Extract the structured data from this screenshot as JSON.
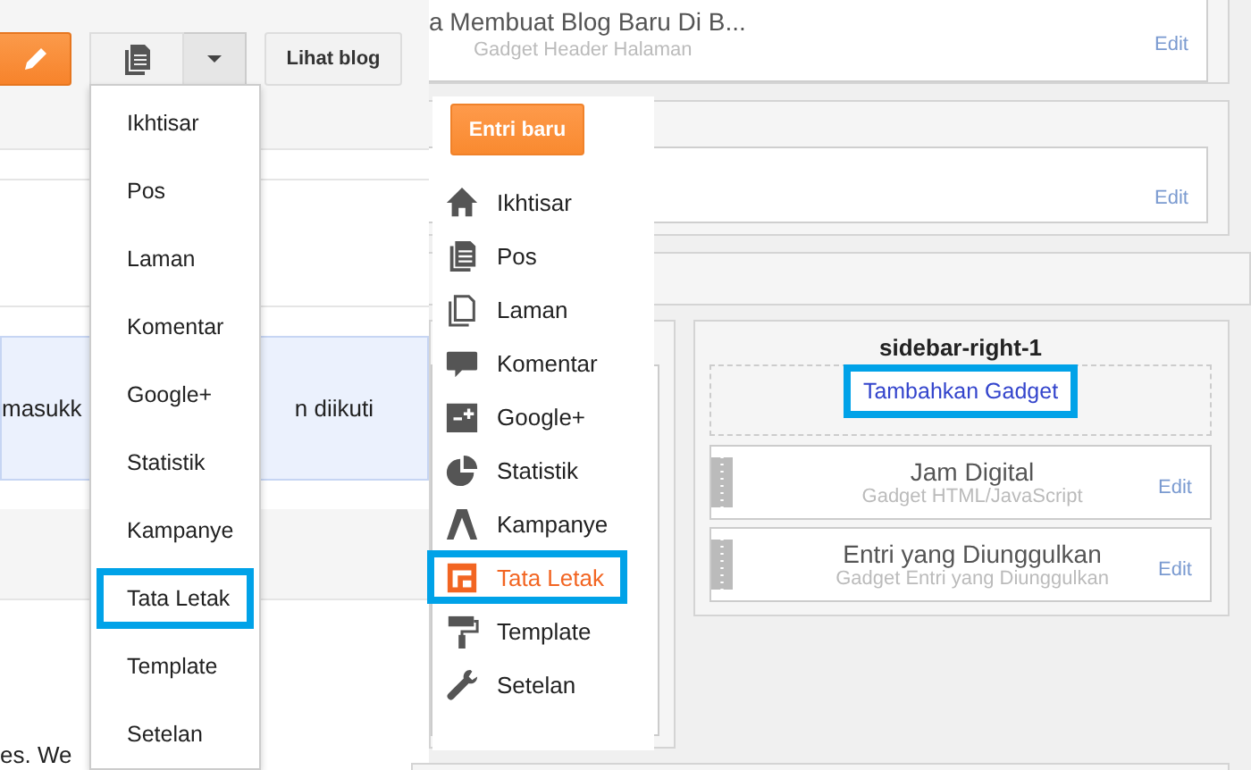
{
  "dashboard": {
    "view_blog_button": "Lihat blog",
    "notice_texts": [
      "masukk",
      "n diikuti"
    ],
    "footer_text": "es. We",
    "menu_items": [
      {
        "label": "Ikhtisar",
        "annotated": false
      },
      {
        "label": "Pos",
        "annotated": false
      },
      {
        "label": "Laman",
        "annotated": false
      },
      {
        "label": "Komentar",
        "annotated": false
      },
      {
        "label": "Google+",
        "annotated": false
      },
      {
        "label": "Statistik",
        "annotated": false
      },
      {
        "label": "Kampanye",
        "annotated": false
      },
      {
        "label": "Tata Letak",
        "annotated": true
      },
      {
        "label": "Template",
        "annotated": false
      },
      {
        "label": "Setelan",
        "annotated": false
      }
    ]
  },
  "layout_editor": {
    "header_gadget": {
      "title": "a Membuat Blog Baru Di B...",
      "subtitle": "Gadget Header Halaman",
      "edit": "Edit"
    },
    "second_gadget": {
      "edit": "Edit"
    },
    "sidebar": {
      "title": "sidebar-right-1",
      "add_gadget": {
        "label": "Tambahkan Gadget",
        "annotated": true
      },
      "gadgets": [
        {
          "title": "Jam Digital",
          "subtitle": "Gadget HTML/JavaScript",
          "edit": "Edit"
        },
        {
          "title": "Entri yang Diunggulkan",
          "subtitle": "Gadget Entri yang Diunggulkan",
          "edit": "Edit"
        }
      ]
    },
    "nav": {
      "new_post_button": "Entri baru",
      "items": [
        {
          "kind": "home",
          "label": "Ikhtisar",
          "selected": false,
          "annotated": false
        },
        {
          "kind": "posts",
          "label": "Pos",
          "selected": false,
          "annotated": false
        },
        {
          "kind": "pages",
          "label": "Laman",
          "selected": false,
          "annotated": false
        },
        {
          "kind": "comments",
          "label": "Komentar",
          "selected": false,
          "annotated": false
        },
        {
          "kind": "gplus",
          "label": "Google+",
          "selected": false,
          "annotated": false
        },
        {
          "kind": "stats",
          "label": "Statistik",
          "selected": false,
          "annotated": false
        },
        {
          "kind": "campaign",
          "label": "Kampanye",
          "selected": false,
          "annotated": false
        },
        {
          "kind": "layout",
          "label": "Tata Letak",
          "selected": true,
          "annotated": true
        },
        {
          "kind": "template",
          "label": "Template",
          "selected": false,
          "annotated": false
        },
        {
          "kind": "settings",
          "label": "Setelan",
          "selected": false,
          "annotated": false
        }
      ]
    }
  }
}
